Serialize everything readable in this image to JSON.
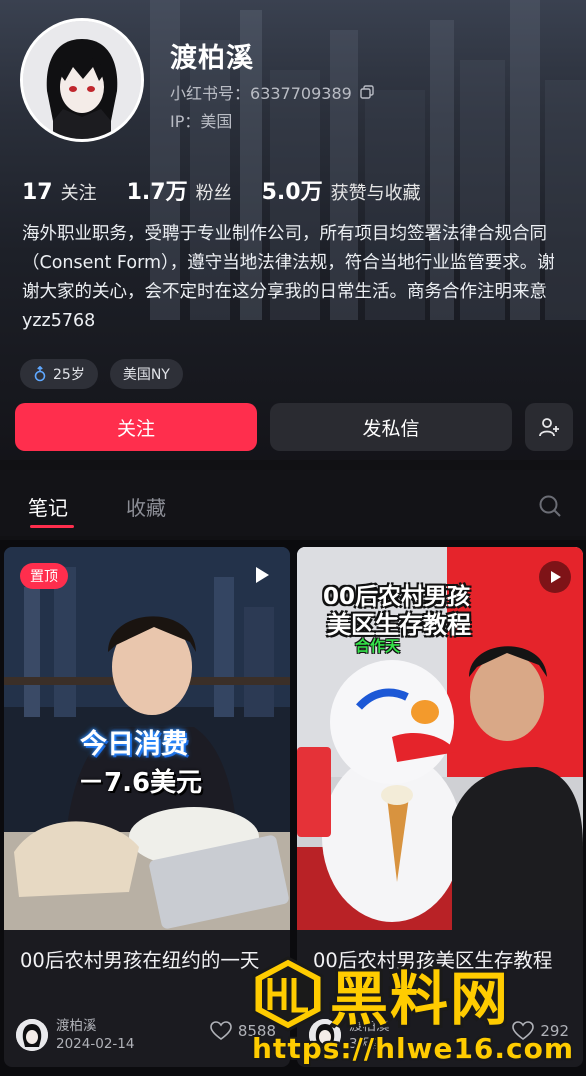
{
  "profile": {
    "name": "渡柏溪",
    "red_id_label": "小红书号：",
    "red_id": "6337709389",
    "ip_label": "IP：",
    "ip": "美国"
  },
  "stats": [
    {
      "num": "17",
      "label": "关注"
    },
    {
      "num": "1.7万",
      "label": "粉丝"
    },
    {
      "num": "5.0万",
      "label": "获赞与收藏"
    }
  ],
  "bio": "海外职业职务，受聘于专业制作公司，所有项目均签署法律合规合同（Consent Form），遵守当地法律法规，符合当地行业监管要求。谢谢大家的关心，会不定时在这分享我的日常生活。商务合作注明来意 yzz5768",
  "tags": {
    "age": "25岁",
    "location": "美国NY"
  },
  "actions": {
    "follow": "关注",
    "message": "发私信"
  },
  "tabs": {
    "notes": "笔记",
    "favorites": "收藏"
  },
  "colors": {
    "accent": "#ff2e4d",
    "background": "#111114"
  },
  "posts": [
    {
      "pinned_label": "置顶",
      "overlay_line1": "今日消费",
      "overlay_line2": "－7.6美元",
      "title": "00后农村男孩在纽约的一天",
      "author": "渡柏溪",
      "date": "2024-02-14",
      "likes": "8588"
    },
    {
      "overlay_line1": "00后农村男孩",
      "overlay_line2": "美区生存教程",
      "overlay_line3": "合作天",
      "title": "00后农村男孩美区生存教程",
      "author": "渡柏溪",
      "date": "3天前",
      "likes": "292"
    }
  ],
  "watermark": {
    "text": "黑料网",
    "url": "https://hlwe16.com"
  }
}
